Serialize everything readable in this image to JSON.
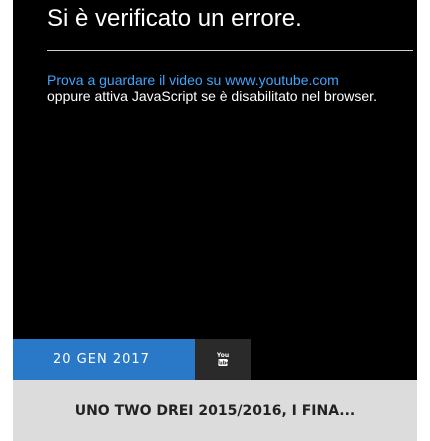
{
  "video": {
    "error_title": "Si è verificato un errore.",
    "link_text": "Prova a guardare il video su www.youtube.com",
    "message_text": "oppure attiva JavaScript se è disabilitato nel browser."
  },
  "meta": {
    "date": "20 GEN 2017",
    "youtube_icon": "youtube-icon"
  },
  "post": {
    "title": "UNO TWO DREI 2015/2016, I FINA..."
  },
  "colors": {
    "date_bar": "#2a79c8",
    "youtube_button": "#2a2a2a",
    "title_bar": "#dcdcdc",
    "link": "#3ea6ff"
  }
}
